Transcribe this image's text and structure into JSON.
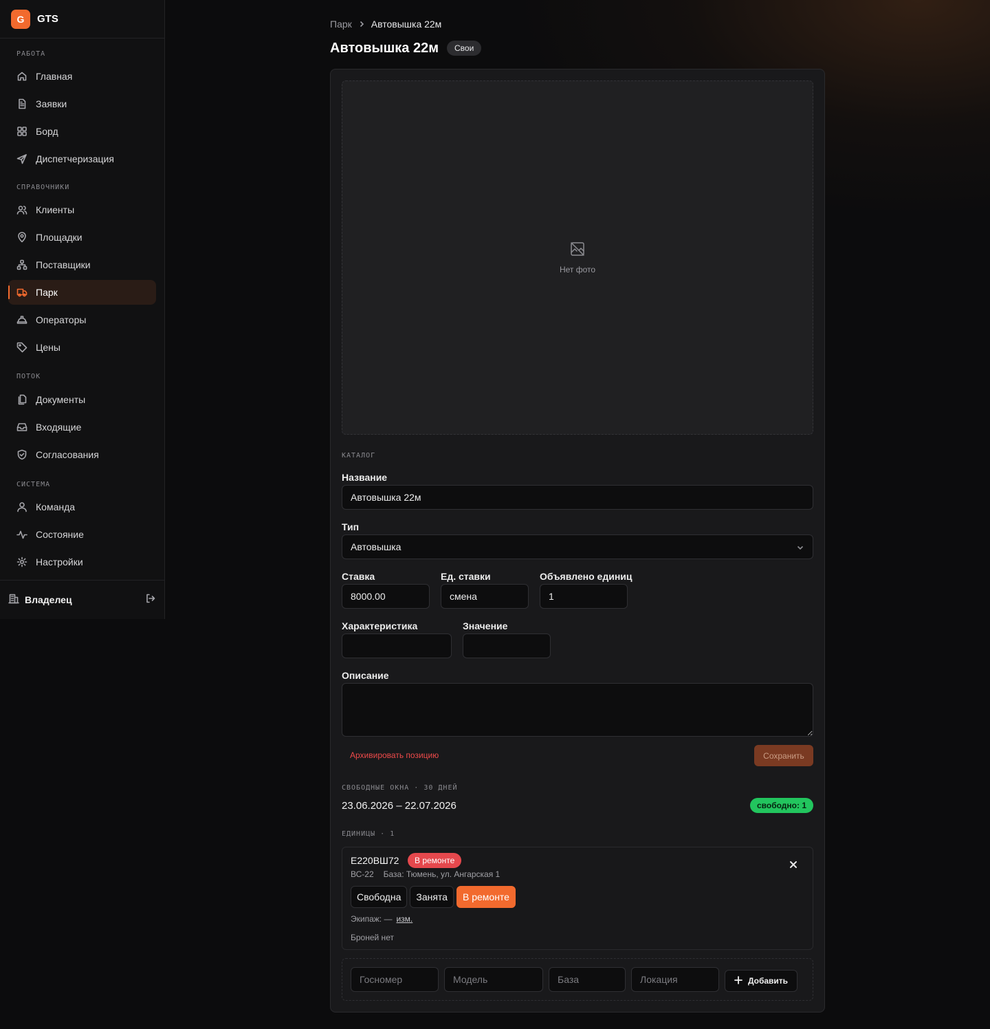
{
  "brand": {
    "logo_letter": "G",
    "name": "GTS",
    "accent": "#f26a2e"
  },
  "sidebar": {
    "sections": [
      {
        "title": "РАБОТА",
        "items": [
          {
            "label": "Главная",
            "icon": "home-icon"
          },
          {
            "label": "Заявки",
            "icon": "document-icon"
          },
          {
            "label": "Борд",
            "icon": "grid-icon"
          },
          {
            "label": "Диспетчеризация",
            "icon": "send-icon"
          }
        ]
      },
      {
        "title": "СПРАВОЧНИКИ",
        "items": [
          {
            "label": "Клиенты",
            "icon": "users-icon"
          },
          {
            "label": "Площадки",
            "icon": "map-pin-icon"
          },
          {
            "label": "Поставщики",
            "icon": "network-icon"
          },
          {
            "label": "Парк",
            "icon": "truck-icon",
            "active": true
          },
          {
            "label": "Операторы",
            "icon": "hard-hat-icon"
          },
          {
            "label": "Цены",
            "icon": "tag-icon"
          }
        ]
      },
      {
        "title": "ПОТОК",
        "items": [
          {
            "label": "Документы",
            "icon": "files-icon"
          },
          {
            "label": "Входящие",
            "icon": "inbox-icon"
          },
          {
            "label": "Согласования",
            "icon": "shield-check-icon"
          }
        ]
      },
      {
        "title": "СИСТЕМА",
        "items": [
          {
            "label": "Команда",
            "icon": "user-icon"
          },
          {
            "label": "Состояние",
            "icon": "activity-icon"
          },
          {
            "label": "Настройки",
            "icon": "gear-icon"
          }
        ]
      }
    ],
    "footer": {
      "label": "Владелец",
      "icon": "building-icon",
      "logout_icon": "logout-icon"
    }
  },
  "breadcrumb": {
    "parent": "Парк",
    "current": "Автовышка 22м"
  },
  "page": {
    "title": "Автовышка 22м",
    "tag": "Свои"
  },
  "photo": {
    "empty_label": "Нет фото",
    "icon": "no-image-icon"
  },
  "catalog": {
    "section_title": "КАТАЛОГ",
    "name_label": "Название",
    "name_value": "Автовышка 22м",
    "type_label": "Тип",
    "type_value": "Автовышка",
    "rate_label": "Ставка",
    "rate_value": "8000.00",
    "rate_unit_label": "Ед. ставки",
    "rate_unit_value": "смена",
    "units_declared_label": "Объявлено единиц",
    "units_declared_value": "1",
    "char_label": "Характеристика",
    "char_value": "",
    "value_label": "Значение",
    "value_value": "",
    "desc_label": "Описание",
    "desc_value": "",
    "archive_label": "Архивировать позицию",
    "save_label": "Сохранить"
  },
  "free_windows": {
    "title": "СВОБОДНЫЕ ОКНА · 30 ДНЕЙ",
    "range": "23.06.2026 – 22.07.2026",
    "badge": "свободно: 1"
  },
  "units": {
    "title": "ЕДИНИЦЫ · 1",
    "items": [
      {
        "plate": "Е220ВШ72",
        "status": "В ремонте",
        "model": "ВС-22",
        "base": "База: Тюмень, ул. Ангарская 1",
        "status_options": [
          "Свободна",
          "Занята",
          "В ремонте"
        ],
        "active_status": "В ремонте",
        "crew_text": "Экипаж: —",
        "crew_change": "изм.",
        "bookings_text": "Броней нет"
      }
    ]
  },
  "add_unit": {
    "plate_placeholder": "Госномер",
    "model_placeholder": "Модель",
    "base_placeholder": "База",
    "location_placeholder": "Локация",
    "add_label": "Добавить"
  }
}
